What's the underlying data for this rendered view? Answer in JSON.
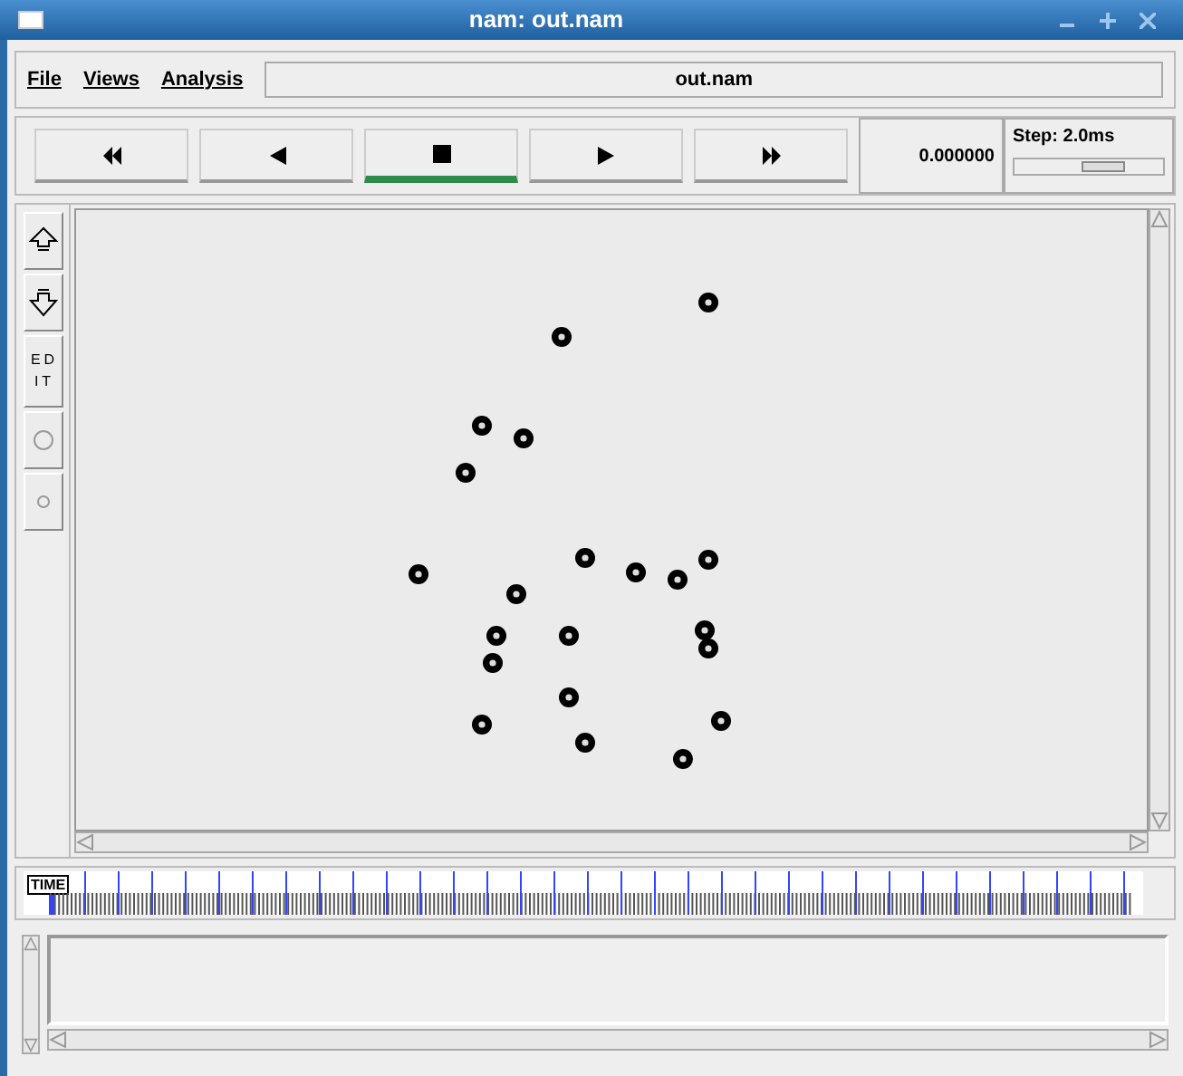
{
  "window": {
    "title": "nam: out.nam"
  },
  "menu": [
    {
      "label": "File"
    },
    {
      "label": "Views"
    },
    {
      "label": "Analysis"
    }
  ],
  "file_name": "out.nam",
  "transport": [
    {
      "kind": "rewind",
      "selected": false
    },
    {
      "kind": "back",
      "selected": false
    },
    {
      "kind": "stop",
      "selected": true
    },
    {
      "kind": "play",
      "selected": false
    },
    {
      "kind": "forward",
      "selected": false
    }
  ],
  "time": "0.000000",
  "step": {
    "label": "Step: 2.0ms",
    "level": 0.6
  },
  "tools": [
    {
      "kind": "zoom-in"
    },
    {
      "kind": "zoom-out"
    },
    {
      "kind": "text",
      "label": "EDIT"
    },
    {
      "kind": "circle-large"
    },
    {
      "kind": "circle-small"
    }
  ],
  "timeline": {
    "label": "TIME",
    "level": 0
  }
}
